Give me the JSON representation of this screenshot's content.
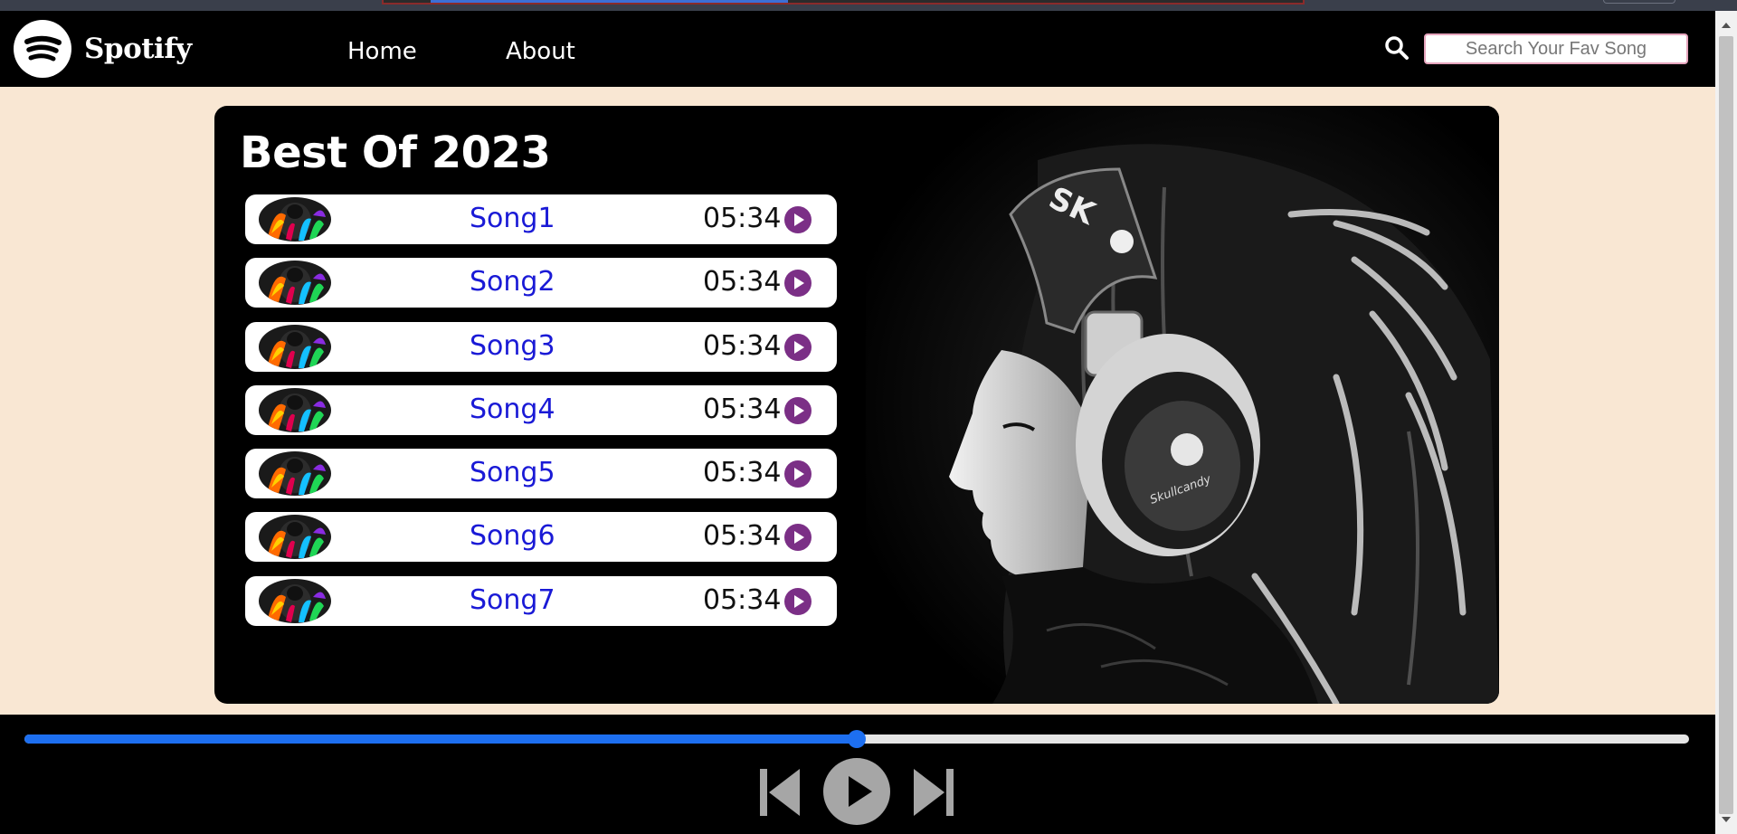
{
  "navbar": {
    "brand": "Spotify",
    "links": [
      {
        "label": "Home"
      },
      {
        "label": "About"
      }
    ],
    "search": {
      "placeholder": "Search Your Fav Song",
      "value": ""
    }
  },
  "playlist": {
    "title": "Best Of 2023",
    "songs": [
      {
        "name": "Song1",
        "duration": "05:34"
      },
      {
        "name": "Song2",
        "duration": "05:34"
      },
      {
        "name": "Song3",
        "duration": "05:34"
      },
      {
        "name": "Song4",
        "duration": "05:34"
      },
      {
        "name": "Song5",
        "duration": "05:34"
      },
      {
        "name": "Song6",
        "duration": "05:34"
      },
      {
        "name": "Song7",
        "duration": "05:34"
      }
    ]
  },
  "player": {
    "progress_percent": 50,
    "icons": [
      "previous-icon",
      "play-icon",
      "next-icon"
    ]
  },
  "colors": {
    "page_background": "#f9e7d3",
    "song_name": "#1a1ad6",
    "play_button": "#7b2f86",
    "progress": "#1d6ff0",
    "control_buttons": "#a6a6a6"
  }
}
